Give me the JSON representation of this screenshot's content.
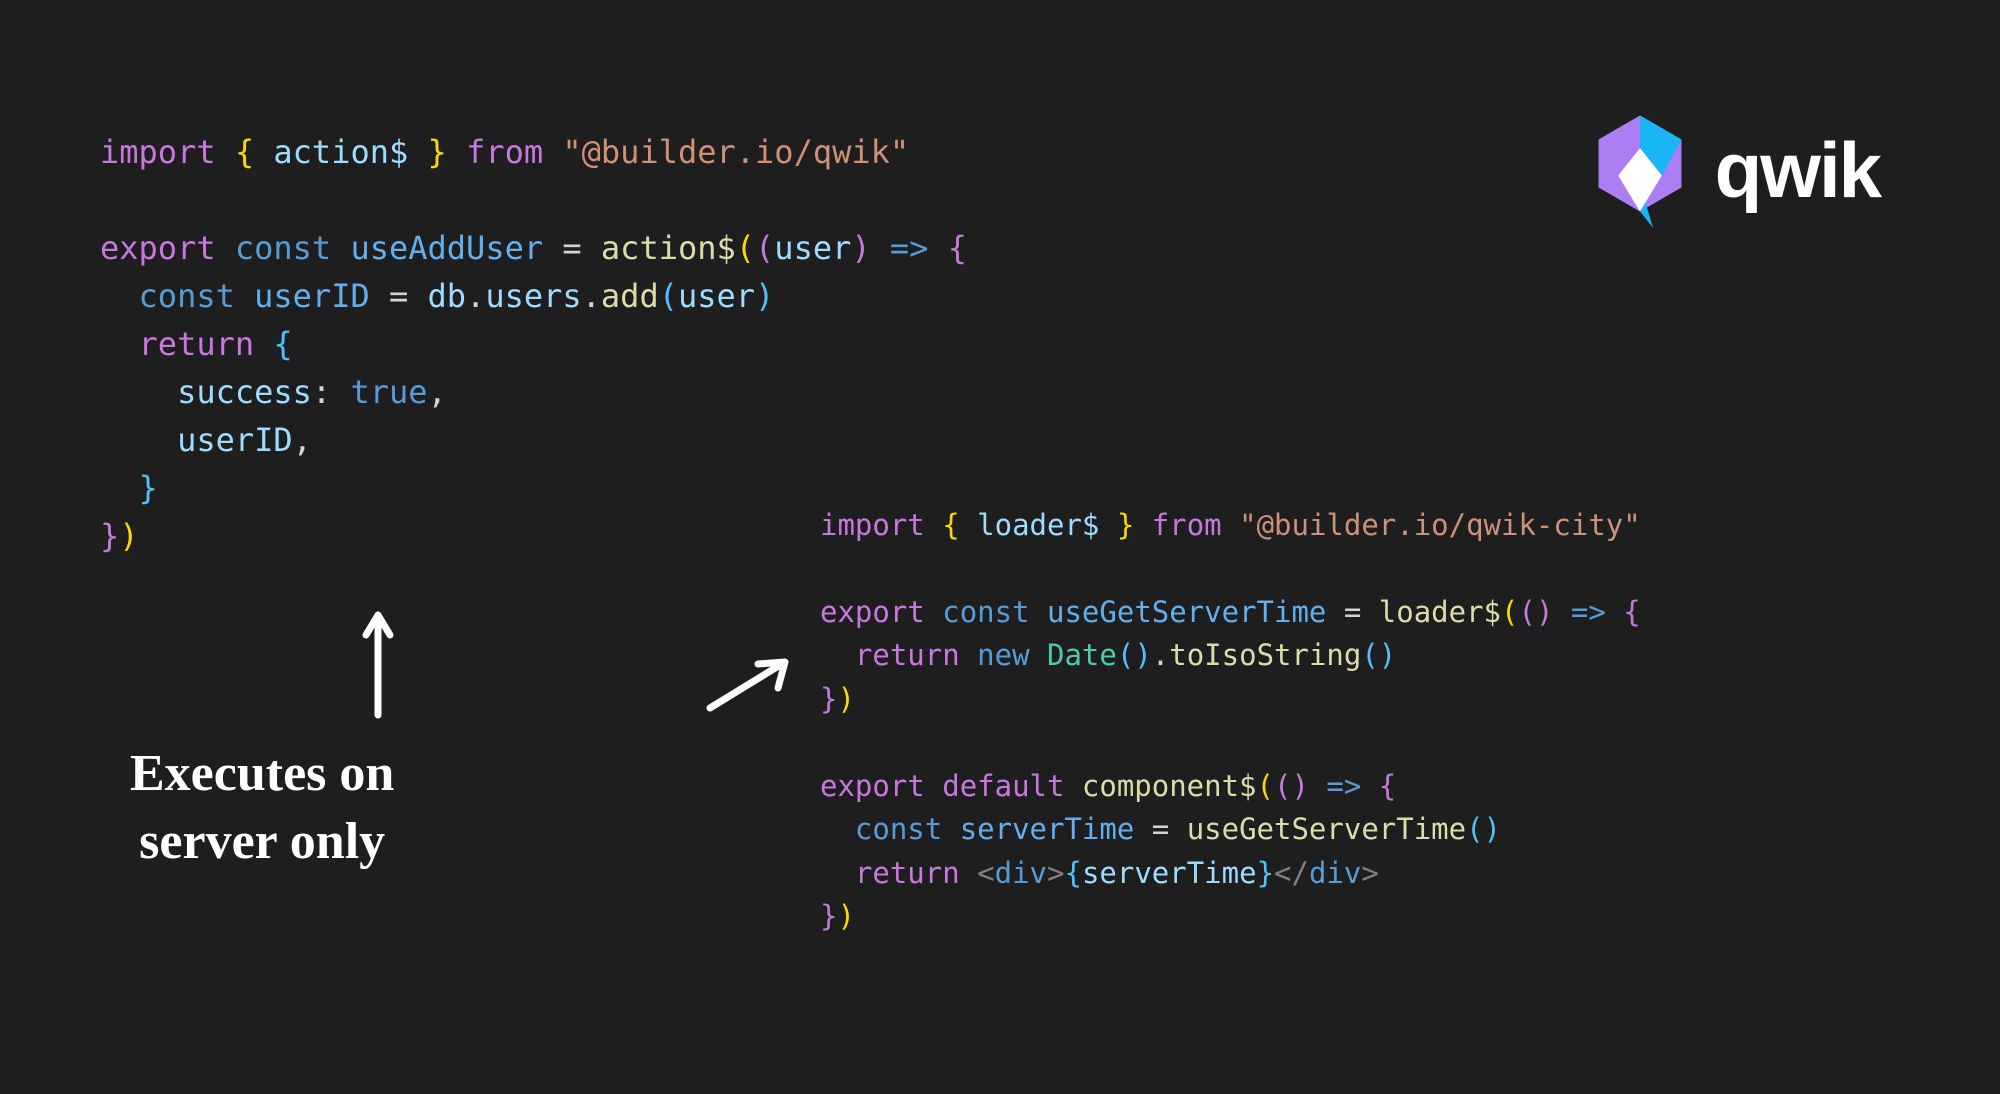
{
  "code_left": {
    "l1": {
      "import": "import",
      "lb": "{",
      "action": "action$",
      "rb": "}",
      "from": "from",
      "str": "\"@builder.io/qwik\""
    },
    "l3": {
      "export": "export",
      "const": "const",
      "name": "useAddUser",
      "eq": "=",
      "fn": "action$",
      "lp": "(",
      "lp2": "(",
      "param": "user",
      "rp2": ")",
      "arrow": "=>",
      "lb": "{"
    },
    "l4": {
      "const": "const",
      "var": "userID",
      "eq": "=",
      "db": "db",
      "dot1": ".",
      "users": "users",
      "dot2": ".",
      "add": "add",
      "lp": "(",
      "arg": "user",
      "rp": ")"
    },
    "l5": {
      "return": "return",
      "lb": "{"
    },
    "l6": {
      "key": "success",
      "colon": ":",
      "val": "true",
      "comma": ","
    },
    "l7": {
      "key": "userID",
      "comma": ","
    },
    "l8": {
      "rb": "}"
    },
    "l9": {
      "rb": "}",
      "rp": ")"
    }
  },
  "code_right": {
    "l1": {
      "import": "import",
      "lb": "{",
      "loader": "loader$",
      "rb": "}",
      "from": "from",
      "str": "\"@builder.io/qwik-city\""
    },
    "l3": {
      "export": "export",
      "const": "const",
      "name": "useGetServerTime",
      "eq": "=",
      "fn": "loader$",
      "lp": "(",
      "lp2": "(",
      "rp2": ")",
      "arrow": "=>",
      "lb": "{"
    },
    "l4": {
      "return": "return",
      "new": "new",
      "cls": "Date",
      "lp": "(",
      "rp": ")",
      "dot": ".",
      "method": "toIsoString",
      "lp2": "(",
      "rp2": ")"
    },
    "l5": {
      "rb": "}",
      "rp": ")"
    },
    "l7": {
      "export": "export",
      "default": "default",
      "fn": "component$",
      "lp": "(",
      "lp2": "(",
      "rp2": ")",
      "arrow": "=>",
      "lb": "{"
    },
    "l8": {
      "const": "const",
      "var": "serverTime",
      "eq": "=",
      "fn": "useGetServerTime",
      "lp": "(",
      "rp": ")"
    },
    "l9": {
      "return": "return",
      "lt": "<",
      "tag": "div",
      "gt": ">",
      "lb": "{",
      "expr": "serverTime",
      "rb": "}",
      "lt2": "</",
      "tag2": "div",
      "gt2": ">"
    },
    "l10": {
      "rb": "}",
      "rp": ")"
    }
  },
  "annotation": {
    "line1": "Executes on",
    "line2": "server only"
  },
  "logo": {
    "text": "qwik"
  }
}
